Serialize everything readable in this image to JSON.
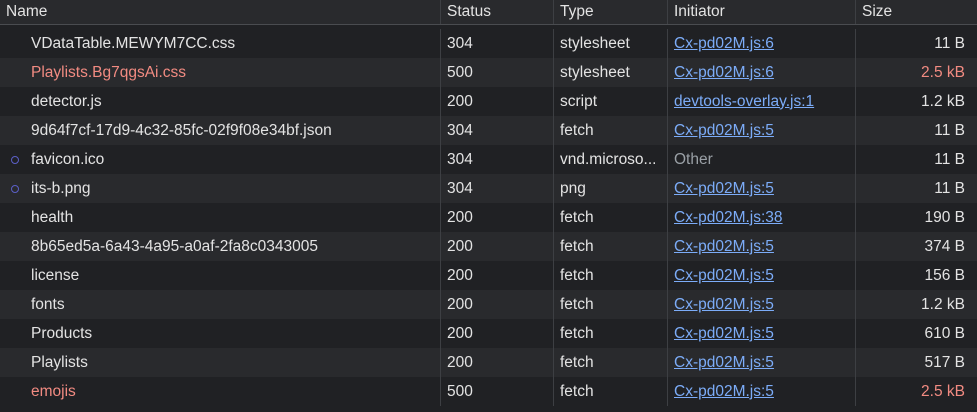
{
  "columns": {
    "name": "Name",
    "status": "Status",
    "type": "Type",
    "initiator": "Initiator",
    "size": "Size"
  },
  "rows": [
    {
      "name": "VDataTable.MEWYM7CC.css",
      "status": "304",
      "type": "stylesheet",
      "initiator": "Cx-pd02M.js:6",
      "size": "11 B"
    },
    {
      "name": "Playlists.Bg7qgsAi.css",
      "status": "500",
      "type": "stylesheet",
      "initiator": "Cx-pd02M.js:6",
      "size": "2.5 kB"
    },
    {
      "name": "detector.js",
      "status": "200",
      "type": "script",
      "initiator": "devtools-overlay.js:1",
      "size": "1.2 kB"
    },
    {
      "name": "9d64f7cf-17d9-4c32-85fc-02f9f08e34bf.json",
      "status": "304",
      "type": "fetch",
      "initiator": "Cx-pd02M.js:5",
      "size": "11 B"
    },
    {
      "name": "favicon.ico",
      "status": "304",
      "type": "vnd.microso...",
      "initiator": "Other",
      "size": "11 B"
    },
    {
      "name": "its-b.png",
      "status": "304",
      "type": "png",
      "initiator": "Cx-pd02M.js:5",
      "size": "11 B"
    },
    {
      "name": "health",
      "status": "200",
      "type": "fetch",
      "initiator": "Cx-pd02M.js:38",
      "size": "190 B"
    },
    {
      "name": "8b65ed5a-6a43-4a95-a0af-2fa8c0343005",
      "status": "200",
      "type": "fetch",
      "initiator": "Cx-pd02M.js:5",
      "size": "374 B"
    },
    {
      "name": "license",
      "status": "200",
      "type": "fetch",
      "initiator": "Cx-pd02M.js:5",
      "size": "156 B"
    },
    {
      "name": "fonts",
      "status": "200",
      "type": "fetch",
      "initiator": "Cx-pd02M.js:5",
      "size": "1.2 kB"
    },
    {
      "name": "Products",
      "status": "200",
      "type": "fetch",
      "initiator": "Cx-pd02M.js:5",
      "size": "610 B"
    },
    {
      "name": "Playlists",
      "status": "200",
      "type": "fetch",
      "initiator": "Cx-pd02M.js:5",
      "size": "517 B"
    },
    {
      "name": "emojis",
      "status": "500",
      "type": "fetch",
      "initiator": "Cx-pd02M.js:5",
      "size": "2.5 kB"
    }
  ],
  "colors": {
    "background": "#202124",
    "row_alt": "#292a2d",
    "error_text": "#f28b82",
    "link": "#7cacf8",
    "muted": "#9aa0a6"
  },
  "icons": {
    "hint": "circle-outline-icon"
  }
}
